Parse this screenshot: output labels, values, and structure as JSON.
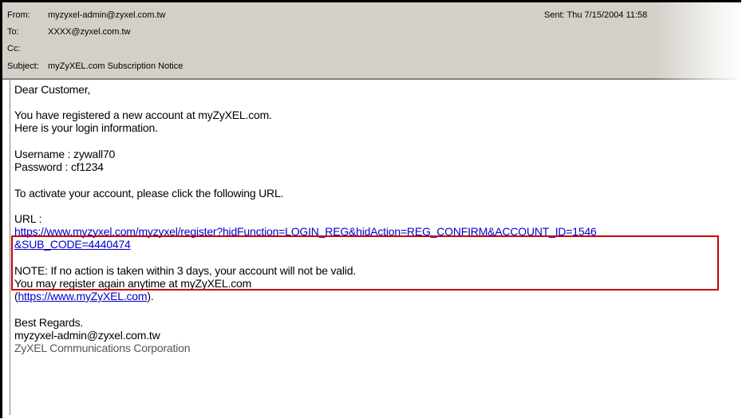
{
  "header": {
    "from_label": "From:",
    "from_value": "myzyxel-admin@zyxel.com.tw",
    "to_label": "To:",
    "to_value": "XXXX@zyxel.com.tw",
    "cc_label": "Cc:",
    "cc_value": "",
    "subject_label": "Subject:",
    "subject_value": "myZyXEL.com Subscription Notice",
    "sent_label": "Sent:",
    "sent_value": "Thu 7/15/2004 11:58"
  },
  "body": {
    "greeting": "Dear Customer,",
    "line1": "You have registered a new account at myZyXEL.com.",
    "line2": "Here is your login information.",
    "username": "Username : zywall70",
    "password": "Password : cf1234",
    "activate": "To activate your account, please click the following URL.",
    "url_label": "URL :",
    "url_line1": "https://www.myzyxel.com/myzyxel/register?hidFunction=LOGIN_REG&hidAction=REG_CONFIRM&ACCOUNT_ID=1546",
    "url_line2": "&SUB_CODE=4440474",
    "note1": "NOTE: If no action is taken within 3 days, your account will not be valid.",
    "note2": "You may register again anytime at myZyXEL.com",
    "note3_open": "(",
    "note3_link": "https://www.myZyXEL.com",
    "note3_close": ").",
    "regards": "Best Regards.",
    "sig_email": "myzyxel-admin@zyxel.com.tw",
    "sig_company": "ZyXEL Communications Corporation"
  },
  "colors": {
    "header_bg": "#d4d0c8",
    "link": "#0000cc",
    "highlight_box": "#cc0000"
  }
}
